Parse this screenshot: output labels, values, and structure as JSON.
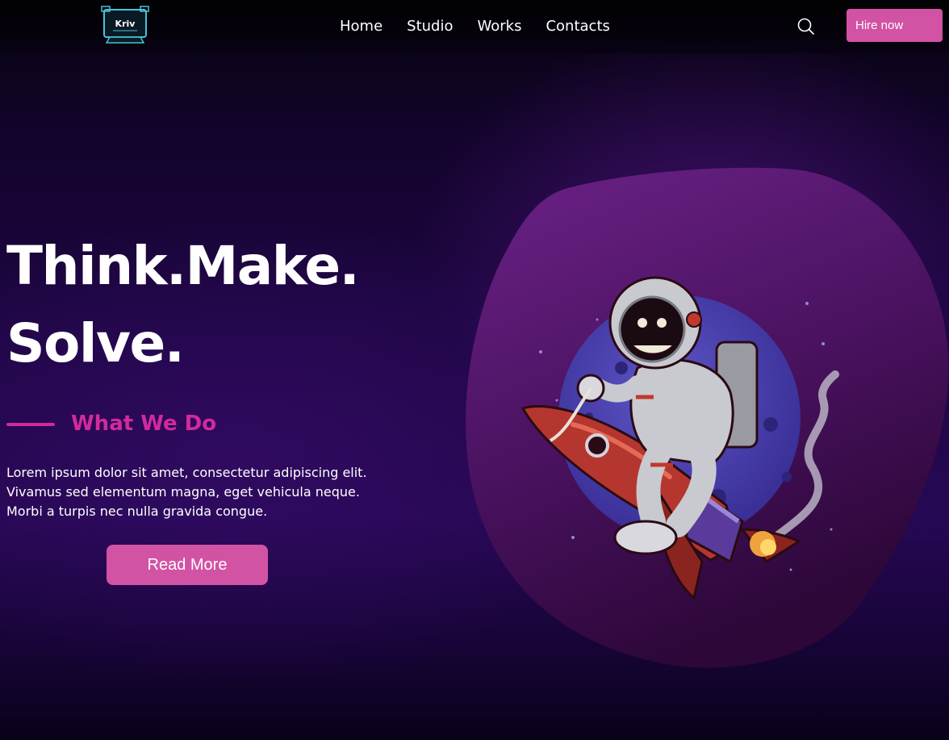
{
  "header": {
    "logo_text": "Kriv",
    "nav": [
      {
        "label": "Home"
      },
      {
        "label": "Studio"
      },
      {
        "label": "Works"
      },
      {
        "label": "Contacts"
      }
    ],
    "search_icon": "search-icon",
    "hire_label": "Hire now"
  },
  "hero": {
    "title_line1": "Think.Make.",
    "title_line2": "Solve.",
    "section_label": "What We Do",
    "desc_lines": [
      "Lorem ipsum dolor sit amet, consectetur adipiscing elit.",
      "Vivamus sed elementum magna, eget vehicula neque.",
      "Morbi a turpis nec nulla gravida congue."
    ],
    "cta_label": "Read More",
    "illustration": "astronaut-riding-rocket"
  },
  "colors": {
    "accent": "#d252a4",
    "heading_accent": "#d22a9c",
    "blob": "#5c1a75",
    "planet": "#4e44b0",
    "rocket": "#b5362e"
  }
}
